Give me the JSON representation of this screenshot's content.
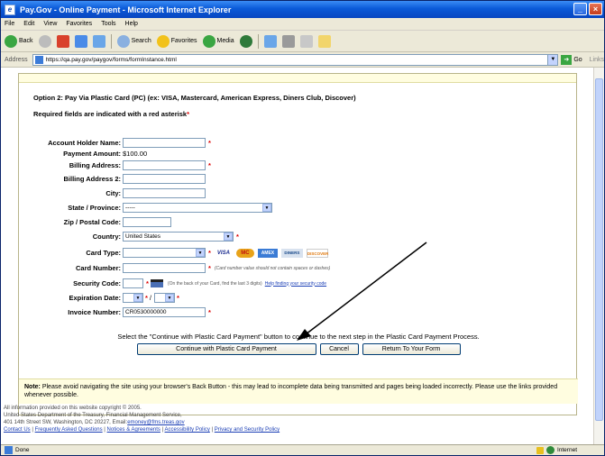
{
  "window": {
    "title": "Pay.Gov - Online Payment - Microsoft Internet Explorer"
  },
  "menu": [
    "File",
    "Edit",
    "View",
    "Favorites",
    "Tools",
    "Help"
  ],
  "toolbar": {
    "back": "Back",
    "search": "Search",
    "favorites": "Favorites",
    "media": "Media"
  },
  "address": {
    "label": "Address",
    "url": "https://qa.pay.gov/paygov/forms/formInstance.html",
    "go": "Go",
    "links": "Links"
  },
  "form": {
    "section_title": "Option 2: Pay Via Plastic Card (PC) (ex: VISA, Mastercard, American Express, Diners Club, Discover)",
    "required_note": "Required fields are indicated with a red asterisk",
    "required_star": "*",
    "fields": {
      "account_holder_label": "Account Holder Name:",
      "payment_amount_label": "Payment Amount:",
      "payment_amount_value": "$100.00",
      "billing_address_label": "Billing Address:",
      "billing_address2_label": "Billing Address 2:",
      "city_label": "City:",
      "state_label": "State / Province:",
      "state_value": "-----",
      "zip_label": "Zip / Postal Code:",
      "country_label": "Country:",
      "country_value": "United States",
      "card_type_label": "Card Type:",
      "card_number_label": "Card Number:",
      "card_number_hint": "(Card number value should not contain spaces or dashes)",
      "security_code_label": "Security Code:",
      "security_code_hint": "(On the back of your Card, find the last 3 digits)",
      "security_code_help": "Help finding your security code",
      "expiration_label": "Expiration Date:",
      "expiration_sep": "/",
      "invoice_label": "Invoice Number:",
      "invoice_value": "CR0530000000"
    },
    "card_logos": [
      "VISA",
      "MC",
      "AMEX",
      "DINERS",
      "DISCOVER"
    ],
    "instruction": "Select the \"Continue with Plastic Card Payment\" button to continue to the next step in the Plastic Card Payment Process.",
    "buttons": {
      "continue": "Continue with Plastic Card Payment",
      "cancel": "Cancel",
      "return": "Return To Your Form"
    },
    "note_label": "Note:",
    "note_text": " Please avoid navigating the site using your browser's Back Button - this may lead to incomplete data being transmitted and pages being loaded incorrectly. Please use the links provided whenever possible."
  },
  "footer": {
    "line1": "All information provided on this website copyright © 2005.",
    "line2": "United States Department of the Treasury, Financial Management Service,",
    "line3": "401 14th Street SW, Washington, DC 20227, Email:",
    "email": "emoney@fms.treas.gov",
    "links": [
      "Contact Us",
      "Frequently Asked Questions",
      "Notices & Agreements",
      "Accessibility Policy",
      "Privacy and Security Policy"
    ],
    "link_sep": " | "
  },
  "status": {
    "left": "Done",
    "zone": "Internet"
  }
}
